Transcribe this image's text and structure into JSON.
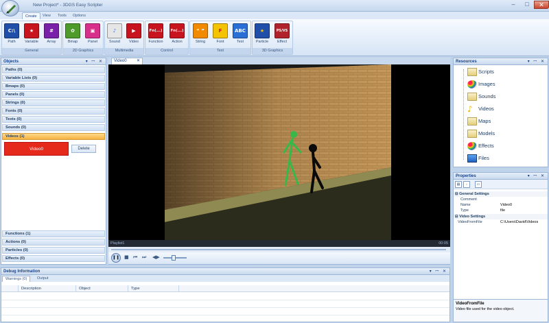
{
  "window": {
    "title": "New Project* - 3DGS Easy Scripter",
    "min": "–",
    "max": "□",
    "close": "✕"
  },
  "menu": {
    "tabs": [
      "Create",
      "View",
      "Tools",
      "Options"
    ]
  },
  "ribbon": {
    "groups": [
      {
        "label": "General",
        "buttons": [
          {
            "label": "Path",
            "glyph": "C:\\",
            "color": "#1f4fa8"
          },
          {
            "label": "Variable",
            "glyph": "★",
            "color": "#c8141e"
          },
          {
            "label": "Array",
            "glyph": "#",
            "color": "#7a1fa8"
          }
        ]
      },
      {
        "label": "2D Graphics",
        "buttons": [
          {
            "label": "Bmap",
            "glyph": "✿",
            "color": "#4e9a2a"
          },
          {
            "label": "Panel",
            "glyph": "▣",
            "color": "#d82f8a"
          }
        ]
      },
      {
        "label": "Multimedia",
        "buttons": [
          {
            "label": "Sound",
            "glyph": "♪",
            "color": "#e6e6e6"
          },
          {
            "label": "Video",
            "glyph": "▶",
            "color": "#c8141e"
          }
        ]
      },
      {
        "label": "Control",
        "buttons": [
          {
            "label": "Function",
            "glyph": "Fn(...)",
            "color": "#c8141e"
          },
          {
            "label": "Action",
            "glyph": "Fn(...)",
            "color": "#c8141e"
          }
        ]
      },
      {
        "label": "Text",
        "buttons": [
          {
            "label": "String",
            "glyph": "“ ”",
            "color": "#f28a00"
          },
          {
            "label": "Font",
            "glyph": "F",
            "color": "#f5c400"
          },
          {
            "label": "Text",
            "glyph": "ABC",
            "color": "#2a6fd6"
          }
        ]
      },
      {
        "label": "3D Graphics",
        "buttons": [
          {
            "label": "Particle",
            "glyph": "★",
            "color": "#1f4fa8"
          },
          {
            "label": "Effect",
            "glyph": "PS/VS",
            "color": "#b0232a"
          }
        ]
      }
    ]
  },
  "objects": {
    "title": "Objects",
    "controls": "▾ ꟷ ✕",
    "categories": [
      "Paths (0)",
      "Variable Lists (0)",
      "Bmaps (0)",
      "Panels (0)",
      "Strings (0)",
      "Fonts (0)",
      "Texts (0)",
      "Sounds (0)",
      "Videos (1)"
    ],
    "bottom_categories": [
      "Functions (1)",
      "Actions (0)",
      "Particles (0)",
      "Effects (0)"
    ],
    "selected_item": "Video0",
    "delete_label": "Delete"
  },
  "document": {
    "tab_label": "Video0",
    "tab_close": "✕",
    "playlist_label": "Playlist1",
    "time": "00:05"
  },
  "debug": {
    "title": "Debug Information",
    "controls": "▾ ꟷ ✕",
    "tabs": [
      "Warnings (0)",
      "Output"
    ],
    "columns": [
      "Description",
      "Object",
      "Type"
    ]
  },
  "resources": {
    "title": "Resources",
    "controls": "▾ ꟷ ✕",
    "items": [
      "Scripts",
      "Images",
      "Sounds",
      "Videos",
      "Maps",
      "Models",
      "Effects",
      "Files"
    ]
  },
  "properties": {
    "title": "Properties",
    "controls": "▾ ꟷ ✕",
    "sections": [
      {
        "name": "General Settings",
        "rows": [
          {
            "key": "Comment",
            "value": ""
          },
          {
            "key": "Name",
            "value": "Video0"
          },
          {
            "key": "Type",
            "value": "file"
          }
        ]
      },
      {
        "name": "Video Settings",
        "rows": [
          {
            "key": "VideoFromFile",
            "value": "C:\\Users\\David\\Videos"
          }
        ]
      }
    ],
    "description_title": "VideoFromFile",
    "description_text": "Video file used for the video object."
  },
  "colors": {
    "selected_item": "#e52a1c",
    "accent": "#15428b",
    "selected_category": "#f5b240"
  }
}
